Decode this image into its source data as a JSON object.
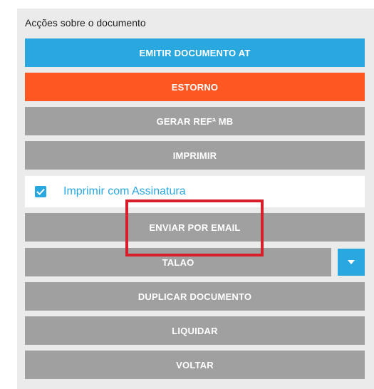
{
  "panel": {
    "title": "Acções sobre o documento"
  },
  "buttons": {
    "emitir": "EMITIR DOCUMENTO AT",
    "estorno": "ESTORNO",
    "gerar_ref": "GERAR REFª MB",
    "imprimir": "IMPRIMIR",
    "enviar_email": "ENVIAR POR EMAIL",
    "talao": "TALAO",
    "duplicar": "DUPLICAR DOCUMENTO",
    "liquidar": "LIQUIDAR",
    "voltar": "VOLTAR"
  },
  "checkbox": {
    "label": "Imprimir com Assinatura",
    "checked": true
  },
  "colors": {
    "primary_blue": "#29a8e0",
    "danger_orange": "#ff5722",
    "neutral_gray": "#a0a0a0",
    "highlight_red": "#d81e2a",
    "panel_bg": "#ebebeb"
  },
  "icons": {
    "checkbox": "check-icon",
    "dropdown": "chevron-down-icon"
  }
}
